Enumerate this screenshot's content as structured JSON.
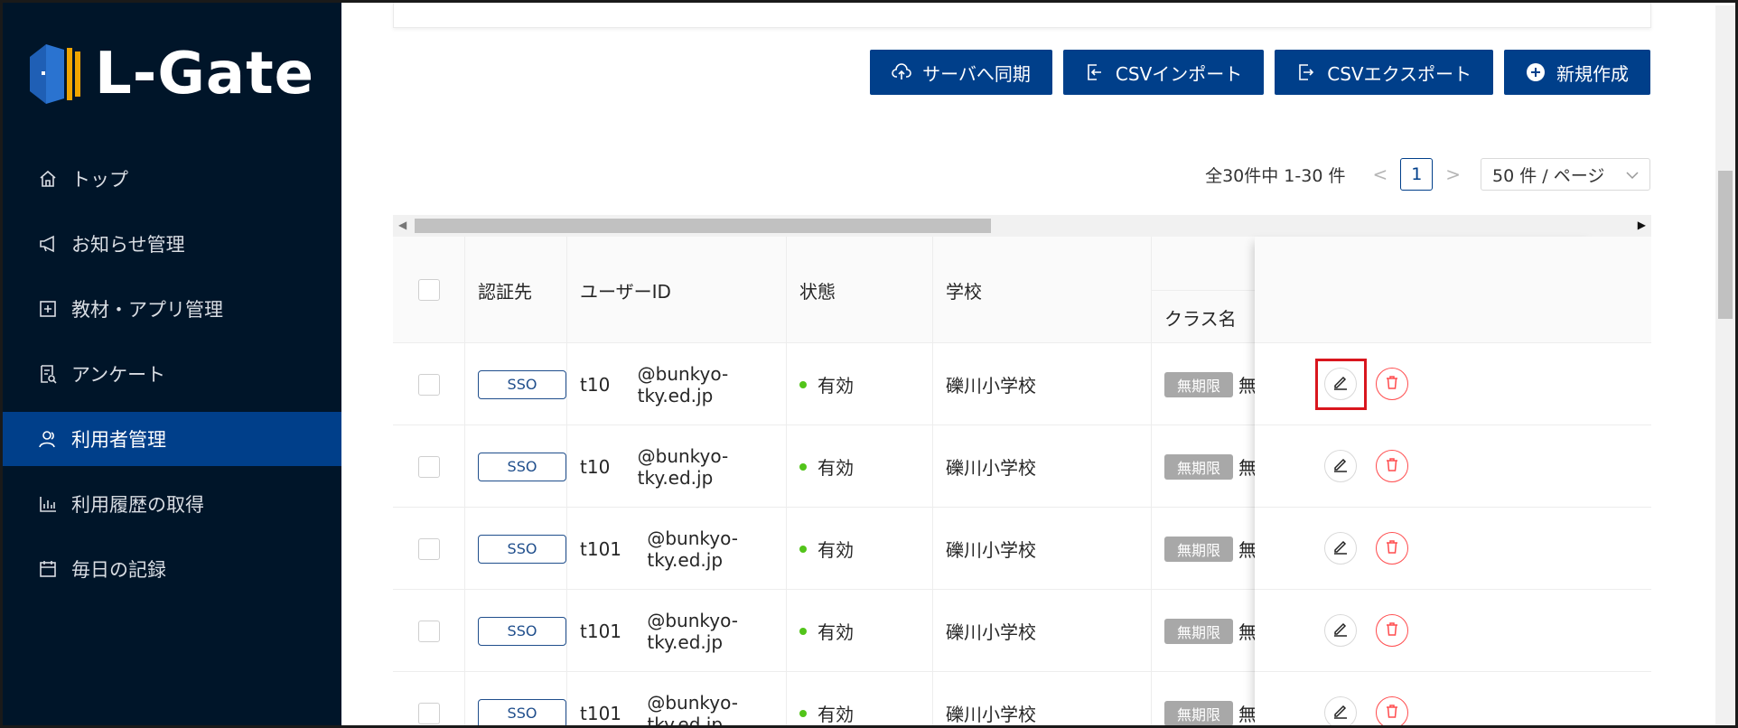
{
  "brand": {
    "name": "L-Gate",
    "colors": {
      "sidebar": "#001529",
      "active": "#003f8a",
      "primary": "#003f8a",
      "danger": "#ff4d4f",
      "success": "#52c41a"
    }
  },
  "sidebar": {
    "items": [
      {
        "label": "トップ",
        "icon": "home-icon"
      },
      {
        "label": "お知らせ管理",
        "icon": "megaphone-icon"
      },
      {
        "label": "教材・アプリ管理",
        "icon": "plus-square-icon"
      },
      {
        "label": "アンケート",
        "icon": "survey-icon"
      },
      {
        "label": "利用者管理",
        "icon": "users-icon",
        "active": true
      },
      {
        "label": "利用履歴の取得",
        "icon": "bar-chart-icon"
      },
      {
        "label": "毎日の記録",
        "icon": "calendar-icon"
      }
    ]
  },
  "toolbar": {
    "sync_label": "サーバへ同期",
    "import_label": "CSVインポート",
    "export_label": "CSVエクスポート",
    "new_label": "新規作成"
  },
  "pagination": {
    "total_text": "全30件中 1-30 件",
    "prev": "<",
    "current": "1",
    "next": ">",
    "page_size": "50 件 / ページ"
  },
  "table": {
    "columns": {
      "auth": "認証先",
      "user_id": "ユーザーID",
      "status": "状態",
      "school": "学校",
      "class_name": "クラス名"
    },
    "rows": [
      {
        "auth": "SSO",
        "uid_prefix": "t10",
        "uid_suffix": "@bunkyo-tky.ed.jp",
        "status": "有効",
        "school": "礫川小学校",
        "tag": "無期限",
        "class_clip": "無",
        "highlighted": true
      },
      {
        "auth": "SSO",
        "uid_prefix": "t10",
        "uid_suffix": "@bunkyo-tky.ed.jp",
        "status": "有効",
        "school": "礫川小学校",
        "tag": "無期限",
        "class_clip": "無"
      },
      {
        "auth": "SSO",
        "uid_prefix": "t101",
        "uid_suffix": "@bunkyo-tky.ed.jp",
        "status": "有効",
        "school": "礫川小学校",
        "tag": "無期限",
        "class_clip": "無"
      },
      {
        "auth": "SSO",
        "uid_prefix": "t101",
        "uid_suffix": "@bunkyo-tky.ed.jp",
        "status": "有効",
        "school": "礫川小学校",
        "tag": "無期限",
        "class_clip": "無"
      },
      {
        "auth": "SSO",
        "uid_prefix": "t101",
        "uid_suffix": "@bunkyo-tky.ed.jp",
        "status": "有効",
        "school": "礫川小学校",
        "tag": "無期限",
        "class_clip": "無"
      }
    ]
  }
}
